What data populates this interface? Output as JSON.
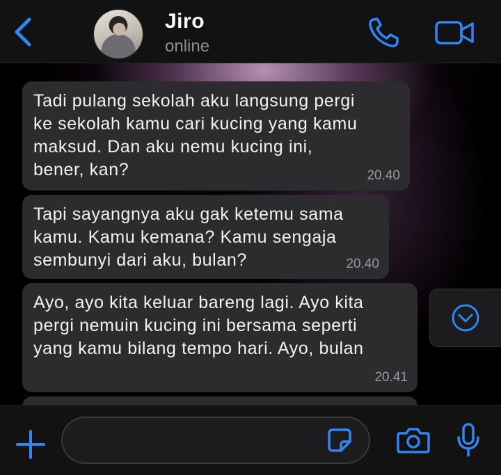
{
  "header": {
    "contact_name": "Jiro",
    "status": "online",
    "icons": [
      "back-chevron-icon",
      "phone-icon",
      "video-camera-icon"
    ]
  },
  "messages": [
    {
      "text": "Tadi pulang sekolah aku langsung pergi\nke sekolah kamu cari kucing yang kamu\nmaksud. Dan aku nemu kucing ini,\nbener, kan?",
      "time": "20.40"
    },
    {
      "text": "Tapi sayangnya aku gak ketemu sama\nkamu. Kamu kemana? Kamu sengaja\nsembunyi dari aku, bulan?",
      "time": "20.40"
    },
    {
      "text": "Ayo, ayo kita keluar bareng lagi. Ayo kita\npergi nemuin kucing ini bersama seperti\nyang kamu bilang tempo hari. Ayo, bulan",
      "time": "20.41"
    }
  ],
  "input": {
    "placeholder": "",
    "icons": [
      "plus-icon",
      "sticker-icon",
      "camera-icon",
      "microphone-icon"
    ]
  },
  "colors": {
    "accent": "#2f86f6",
    "bubble": "#2c2c2e",
    "background": "#000000"
  }
}
